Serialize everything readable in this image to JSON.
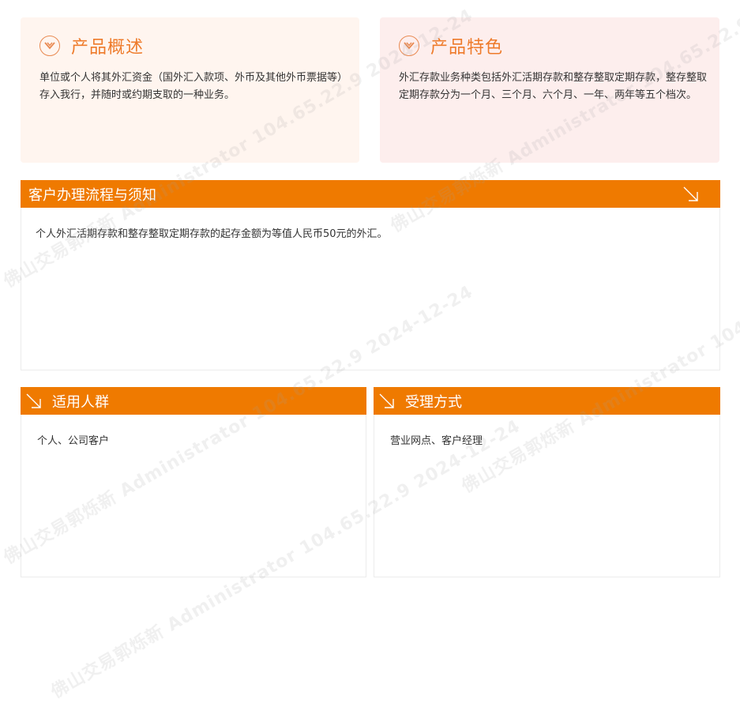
{
  "overview": {
    "title": "产品概述",
    "text": "单位或个人将其外汇资金（国外汇入款项、外币及其他外币票据等）存入我行，并随时或约期支取的一种业务。"
  },
  "features": {
    "title": "产品特色",
    "text": "外汇存款业务种类包括外汇活期存款和整存整取定期存款，整存整取定期存款分为一个月、三个月、六个月、一年、两年等五个档次。"
  },
  "process": {
    "title": "客户办理流程与须知",
    "text": "个人外汇活期存款和整存整取定期存款的起存金额为等值人民币50元的外汇。"
  },
  "audience": {
    "title": "适用人群",
    "text": "个人、公司客户"
  },
  "channel": {
    "title": "受理方式",
    "text": "营业网点、客户经理"
  },
  "watermark": {
    "text": "佛山交易郭烁新  Administrator  104.65.22.9  2024-12-24"
  },
  "colors": {
    "accent": "#ef7a00",
    "title_orange": "#ee7b2b",
    "card_left_bg": "#fff5ef",
    "card_right_bg": "#fdeeed"
  },
  "icons": {
    "card_icon": "chevron-down-circle-icon",
    "panel_icon": "diagonal-arrow-icon"
  }
}
